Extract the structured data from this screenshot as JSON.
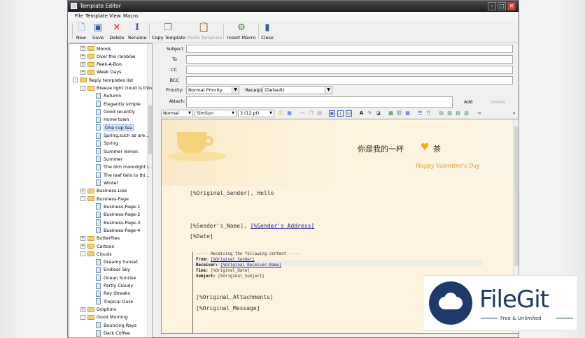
{
  "window": {
    "title": "Template Editor"
  },
  "menu": [
    "File",
    "Template",
    "View",
    "Macro"
  ],
  "toolbar": [
    {
      "label": "New",
      "icon": "new-doc-icon",
      "disabled": false
    },
    {
      "label": "Save",
      "icon": "save-icon",
      "disabled": false
    },
    {
      "label": "Delete",
      "icon": "delete-icon",
      "disabled": false
    },
    {
      "label": "Rename",
      "icon": "rename-icon",
      "disabled": false
    },
    {
      "label": "Copy Template",
      "icon": "copy-icon",
      "disabled": false
    },
    {
      "label": "Paste Template",
      "icon": "paste-icon",
      "disabled": true
    },
    {
      "label": "Insert Macro",
      "icon": "macro-icon",
      "disabled": false
    },
    {
      "label": "Close",
      "icon": "close-book-icon",
      "disabled": false
    }
  ],
  "tree": [
    {
      "label": "Moods",
      "type": "folder",
      "level": 1,
      "expander": "+"
    },
    {
      "label": "Over the rainbow",
      "type": "folder",
      "level": 1,
      "expander": "+"
    },
    {
      "label": "Peek-A-Boo",
      "type": "folder",
      "level": 1,
      "expander": "+"
    },
    {
      "label": "Week Days",
      "type": "folder",
      "level": 1,
      "expander": "+"
    },
    {
      "label": "Reply templates list",
      "type": "folder",
      "level": 0,
      "expander": "-"
    },
    {
      "label": "Breeze light cloud is thin",
      "type": "folder",
      "level": 1,
      "expander": "-"
    },
    {
      "label": "Autumn",
      "type": "doc",
      "level": 2
    },
    {
      "label": "Elegantly simple",
      "type": "doc",
      "level": 2
    },
    {
      "label": "Good recently",
      "type": "doc",
      "level": 2
    },
    {
      "label": "Home town",
      "type": "doc",
      "level": 2
    },
    {
      "label": "One cup tea",
      "type": "doc",
      "level": 2,
      "selected": true
    },
    {
      "label": "Spring,such as are...",
      "type": "doc",
      "level": 2
    },
    {
      "label": "Spring",
      "type": "doc",
      "level": 2
    },
    {
      "label": "Summer lemon",
      "type": "doc",
      "level": 2
    },
    {
      "label": "Summer",
      "type": "doc",
      "level": 2
    },
    {
      "label": "The dim moonlight i...",
      "type": "doc",
      "level": 2
    },
    {
      "label": "The leaf falls to thi...",
      "type": "doc",
      "level": 2
    },
    {
      "label": "Winter",
      "type": "doc",
      "level": 2
    },
    {
      "label": "Business-Like",
      "type": "folder",
      "level": 1,
      "expander": "+"
    },
    {
      "label": "Business-Page",
      "type": "folder",
      "level": 1,
      "expander": "-"
    },
    {
      "label": "Business-Page-1",
      "type": "doc",
      "level": 2
    },
    {
      "label": "Business-Page-2",
      "type": "doc",
      "level": 2
    },
    {
      "label": "Business-Page-3",
      "type": "doc",
      "level": 2
    },
    {
      "label": "Business-Page-4",
      "type": "doc",
      "level": 2
    },
    {
      "label": "Butterflies",
      "type": "folder",
      "level": 1,
      "expander": "+"
    },
    {
      "label": "Cartoon",
      "type": "folder",
      "level": 1,
      "expander": "+"
    },
    {
      "label": "Clouds",
      "type": "folder",
      "level": 1,
      "expander": "-"
    },
    {
      "label": "Dreamy Sunset",
      "type": "doc",
      "level": 2
    },
    {
      "label": "Endless Sky",
      "type": "doc",
      "level": 2
    },
    {
      "label": "Ocean Sunrise",
      "type": "doc",
      "level": 2
    },
    {
      "label": "Partly Cloudy",
      "type": "doc",
      "level": 2
    },
    {
      "label": "Ray Streaks",
      "type": "doc",
      "level": 2
    },
    {
      "label": "Tropical Dusk",
      "type": "doc",
      "level": 2
    },
    {
      "label": "Dolphins",
      "type": "folder",
      "level": 1,
      "expander": "+"
    },
    {
      "label": "Good Morning",
      "type": "folder",
      "level": 1,
      "expander": "-"
    },
    {
      "label": "Bouncing Rays",
      "type": "doc",
      "level": 2
    },
    {
      "label": "Dark Coffee",
      "type": "doc",
      "level": 2
    }
  ],
  "form": {
    "subject_label": "Subject",
    "to_label": "To",
    "cc_label": "CC",
    "bcc_label": "BCC",
    "priority_label": "Priority:",
    "priority_value": "Normal Priority",
    "receipt_label": "Receipt:",
    "receipt_value": "(Default)",
    "attach_label": "Attach:",
    "add_label": "Add",
    "delete_label": "Delete"
  },
  "format": {
    "style": "Normal",
    "font": "SimSun",
    "size": "3 (12 pt)"
  },
  "editor": {
    "banner_cn_1": "你是我的一杯",
    "banner_heart": "♥",
    "banner_cn_2": "茶",
    "banner_en": "Happy Valentine's Day",
    "greeting_macro": "[%Original_Sender]",
    "greeting_text": ", Hello",
    "sender_name": "[%Sender's_Name]",
    "separator": ", ",
    "sender_address": "[%Sender's_Address]",
    "date": "[%Date]",
    "quote_header": "----- Receiving the following content -----",
    "from_label": "From:",
    "from_value": "[%Original_Sender]",
    "receiver_label": "Receiver:",
    "receiver_value": "[%Original_Receiver-Name]",
    "time_label": "Time:",
    "time_value": "[%Original_Date]",
    "subject_label": "Subject:",
    "subject_value": "[%Original_Subject]",
    "attachments": "[%Original_Attachments]",
    "message": "[%Original_Message]"
  },
  "watermark": {
    "brand": "FileGit",
    "tagline": "Free & Unlimited"
  }
}
